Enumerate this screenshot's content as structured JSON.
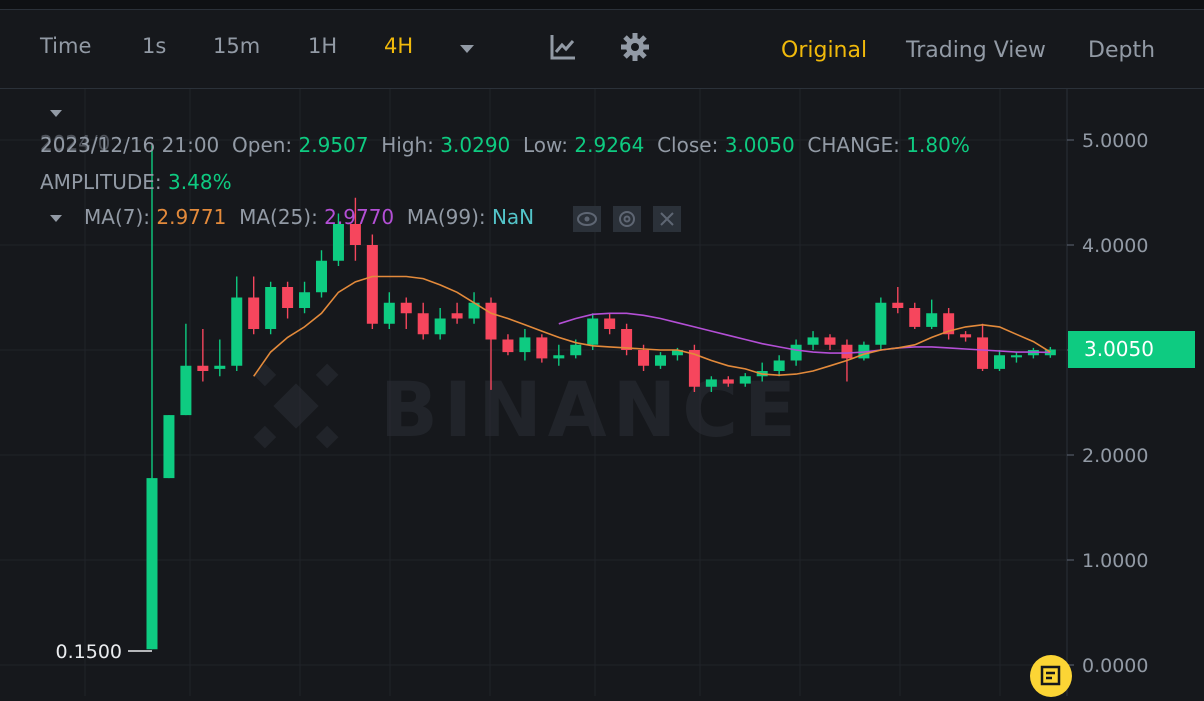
{
  "toolbar": {
    "time_label": "Time",
    "intervals": [
      "1s",
      "15m",
      "1H",
      "4H"
    ],
    "active_interval": "4H",
    "views": [
      "Original",
      "Trading View",
      "Depth"
    ],
    "active_view": "Original"
  },
  "legend": {
    "datetime": "2023/12/16 21:00",
    "overlap_text": "2024/0",
    "open_label": "Open:",
    "open": "2.9507",
    "high_label": "High:",
    "high": "3.0290",
    "low_label": "Low:",
    "low": "2.9264",
    "close_label": "Close:",
    "close": "3.0050",
    "change_label": "CHANGE:",
    "change": "1.80%",
    "amplitude_label": "AMPLITUDE:",
    "amplitude": "3.48%",
    "ma7_label": "MA(7):",
    "ma7": "2.9771",
    "ma25_label": "MA(25):",
    "ma25": "2.9770",
    "ma99_label": "MA(99):",
    "ma99": "NaN"
  },
  "colors": {
    "up": "#0ecb81",
    "down": "#f6465d",
    "ma7": "#e38a3b",
    "ma25": "#b44fd6",
    "ma99": "#53c4c9",
    "accent": "#f0b90b"
  },
  "watermark": "BINANCE",
  "current_price": "3.0050",
  "min_marker": "0.1500",
  "chart_data": {
    "type": "candlestick",
    "y_ticks": [
      "5.0000",
      "4.0000",
      "3.0000",
      "2.0000",
      "1.0000",
      "0.0000"
    ],
    "ylim": [
      0,
      5
    ],
    "candles": [
      [
        0.15,
        1.78,
        0.15,
        4.95
      ],
      [
        1.78,
        2.38,
        1.78,
        2.38
      ],
      [
        2.38,
        2.85,
        2.38,
        3.25
      ],
      [
        2.85,
        2.8,
        2.7,
        3.2
      ],
      [
        2.82,
        2.85,
        2.75,
        3.1
      ],
      [
        2.85,
        3.5,
        2.8,
        3.7
      ],
      [
        3.5,
        3.2,
        3.15,
        3.7
      ],
      [
        3.2,
        3.6,
        3.15,
        3.65
      ],
      [
        3.6,
        3.4,
        3.3,
        3.65
      ],
      [
        3.4,
        3.55,
        3.35,
        3.65
      ],
      [
        3.55,
        3.85,
        3.5,
        3.95
      ],
      [
        3.85,
        4.2,
        3.8,
        4.3
      ],
      [
        4.2,
        4.0,
        3.85,
        4.45
      ],
      [
        4.0,
        3.25,
        3.2,
        4.1
      ],
      [
        3.25,
        3.45,
        3.2,
        3.55
      ],
      [
        3.45,
        3.35,
        3.2,
        3.5
      ],
      [
        3.35,
        3.15,
        3.1,
        3.45
      ],
      [
        3.15,
        3.3,
        3.1,
        3.4
      ],
      [
        3.35,
        3.3,
        3.25,
        3.45
      ],
      [
        3.3,
        3.45,
        3.25,
        3.55
      ],
      [
        3.45,
        3.1,
        2.62,
        3.5
      ],
      [
        3.1,
        2.98,
        2.95,
        3.15
      ],
      [
        2.98,
        3.12,
        2.9,
        3.2
      ],
      [
        3.12,
        2.92,
        2.88,
        3.15
      ],
      [
        2.92,
        2.95,
        2.85,
        3.05
      ],
      [
        2.95,
        3.05,
        2.92,
        3.1
      ],
      [
        3.05,
        3.3,
        3.0,
        3.35
      ],
      [
        3.3,
        3.2,
        3.15,
        3.35
      ],
      [
        3.2,
        3.0,
        2.95,
        3.25
      ],
      [
        3.0,
        2.85,
        2.8,
        3.05
      ],
      [
        2.85,
        2.95,
        2.82,
        2.98
      ],
      [
        2.95,
        3.0,
        2.9,
        3.02
      ],
      [
        3.0,
        2.65,
        2.6,
        3.05
      ],
      [
        2.65,
        2.72,
        2.6,
        2.75
      ],
      [
        2.72,
        2.68,
        2.65,
        2.75
      ],
      [
        2.68,
        2.75,
        2.65,
        2.78
      ],
      [
        2.75,
        2.8,
        2.7,
        2.88
      ],
      [
        2.8,
        2.9,
        2.75,
        2.95
      ],
      [
        2.9,
        3.05,
        2.85,
        3.1
      ],
      [
        3.05,
        3.12,
        3.0,
        3.18
      ],
      [
        3.12,
        3.05,
        3.0,
        3.15
      ],
      [
        3.05,
        2.92,
        2.7,
        3.1
      ],
      [
        2.92,
        3.05,
        2.9,
        3.08
      ],
      [
        3.05,
        3.45,
        3.0,
        3.5
      ],
      [
        3.45,
        3.4,
        3.35,
        3.6
      ],
      [
        3.4,
        3.22,
        3.2,
        3.45
      ],
      [
        3.22,
        3.35,
        3.2,
        3.48
      ],
      [
        3.35,
        3.15,
        3.1,
        3.4
      ],
      [
        3.15,
        3.12,
        3.08,
        3.18
      ],
      [
        3.12,
        2.82,
        2.8,
        3.25
      ],
      [
        2.82,
        2.95,
        2.8,
        3.0
      ],
      [
        2.93,
        2.95,
        2.88,
        2.98
      ],
      [
        2.95,
        3.0,
        2.92,
        3.02
      ],
      [
        2.95,
        3.005,
        2.926,
        3.029
      ]
    ],
    "ma7": [
      null,
      null,
      null,
      null,
      null,
      null,
      2.75,
      2.98,
      3.12,
      3.22,
      3.35,
      3.55,
      3.65,
      3.7,
      3.7,
      3.7,
      3.68,
      3.62,
      3.55,
      3.45,
      3.35,
      3.3,
      3.24,
      3.18,
      3.12,
      3.07,
      3.04,
      3.03,
      3.02,
      3.01,
      3.0,
      3.0,
      2.96,
      2.9,
      2.85,
      2.82,
      2.77,
      2.76,
      2.77,
      2.8,
      2.85,
      2.9,
      2.96,
      3.0,
      3.02,
      3.05,
      3.12,
      3.18,
      3.22,
      3.24,
      3.22,
      3.15,
      3.08,
      2.98
    ],
    "ma25": [
      null,
      null,
      null,
      null,
      null,
      null,
      null,
      null,
      null,
      null,
      null,
      null,
      null,
      null,
      null,
      null,
      null,
      null,
      null,
      null,
      null,
      null,
      null,
      null,
      3.25,
      3.3,
      3.34,
      3.35,
      3.35,
      3.33,
      3.3,
      3.26,
      3.22,
      3.18,
      3.14,
      3.1,
      3.06,
      3.03,
      3.0,
      2.98,
      2.97,
      2.97,
      2.98,
      3.0,
      3.02,
      3.03,
      3.03,
      3.02,
      3.01,
      3.0,
      2.99,
      2.98,
      2.98,
      2.977
    ],
    "ma99": []
  }
}
